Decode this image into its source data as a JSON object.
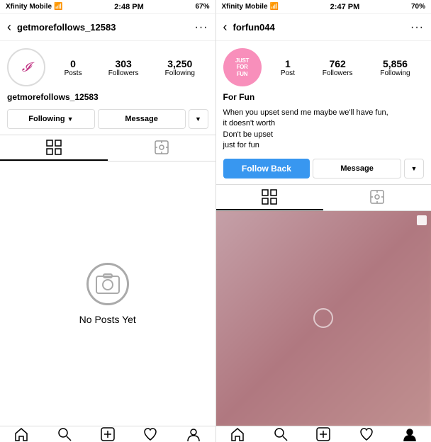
{
  "left": {
    "carrier": "Xfinity Mobile",
    "time": "2:48 PM",
    "signal": "67%",
    "username": "getmorefollows_12583",
    "stats": {
      "posts": {
        "value": "0",
        "label": "Posts"
      },
      "followers": {
        "value": "303",
        "label": "Followers"
      },
      "following": {
        "value": "3,250",
        "label": "Following"
      }
    },
    "bio": "",
    "buttons": {
      "following": "Following",
      "message": "Message"
    },
    "no_posts_text": "No Posts Yet",
    "tabs": {
      "grid": "Grid",
      "tagged": "Tagged"
    }
  },
  "right": {
    "carrier": "Xfinity Mobile",
    "time": "2:47 PM",
    "signal": "70%",
    "username": "forfun044",
    "avatar_text": "JUST FOR FUN",
    "stats": {
      "posts": {
        "value": "1",
        "label": "Post"
      },
      "followers": {
        "value": "762",
        "label": "Followers"
      },
      "following": {
        "value": "5,856",
        "label": "Following"
      }
    },
    "bio_name": "For Fun",
    "bio_lines": [
      "When you upset send me maybe we'll have fun,",
      "it doesn't worth",
      "Don't be upset",
      "just for fun"
    ],
    "buttons": {
      "follow_back": "Follow Back",
      "message": "Message"
    }
  },
  "nav": {
    "back": "‹",
    "more": "···"
  },
  "bottom_nav": {
    "items": [
      "home",
      "search",
      "add",
      "heart",
      "profile"
    ]
  }
}
